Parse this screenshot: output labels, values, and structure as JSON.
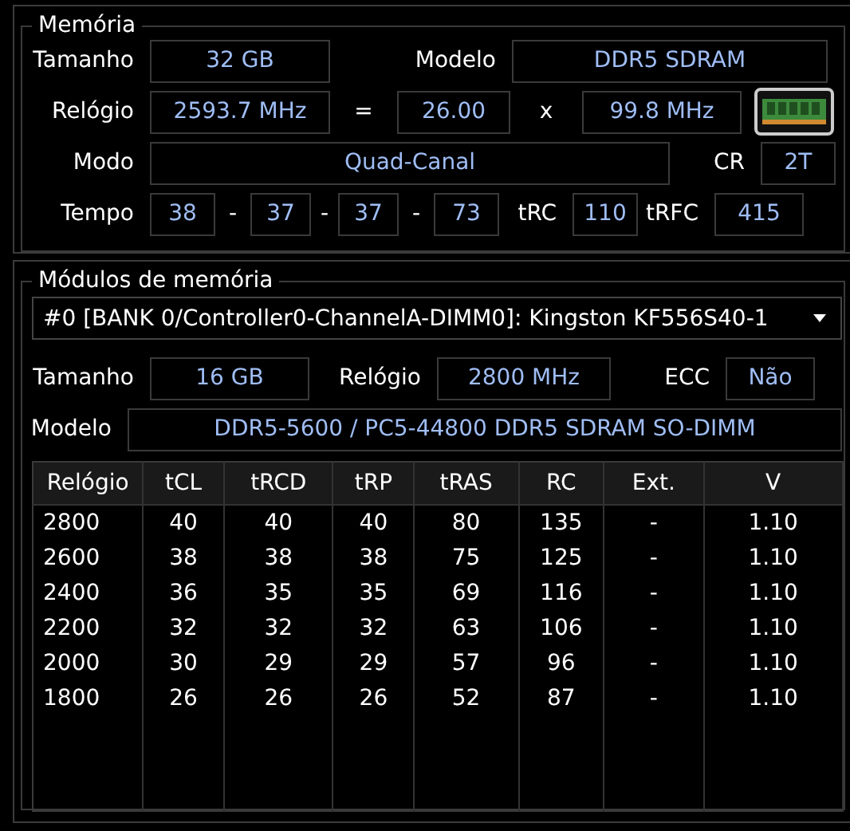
{
  "memory": {
    "title": "Memória",
    "size_label": "Tamanho",
    "size": "32 GB",
    "model_label": "Modelo",
    "model": "DDR5 SDRAM",
    "clock_label": "Relógio",
    "clock": "2593.7 MHz",
    "equals": "=",
    "multiplier": "26.00",
    "times": "x",
    "bus": "99.8 MHz",
    "mode_label": "Modo",
    "mode": "Quad-Canal",
    "cr_label": "CR",
    "cr": "2T",
    "timings_label": "Tempo",
    "timings": [
      "38",
      "37",
      "37",
      "73"
    ],
    "separators": [
      "-",
      "-",
      "-"
    ],
    "trc_label": "tRC",
    "trc": "110",
    "trfc_label": "tRFC",
    "trfc": "415"
  },
  "modules": {
    "title": "Módulos de memória",
    "selector": "#0 [BANK 0/Controller0-ChannelA-DIMM0]: Kingston KF556S40-1",
    "size_label": "Tamanho",
    "size": "16 GB",
    "clock_label": "Relógio",
    "clock": "2800 MHz",
    "ecc_label": "ECC",
    "ecc": "Não",
    "model_label": "Modelo",
    "model": "DDR5-5600 / PC5-44800 DDR5 SDRAM SO-DIMM",
    "table": {
      "columns": [
        "Relógio",
        "tCL",
        "tRCD",
        "tRP",
        "tRAS",
        "RC",
        "Ext.",
        "V"
      ],
      "rows": [
        [
          "2800",
          "40",
          "40",
          "40",
          "80",
          "135",
          "-",
          "1.10"
        ],
        [
          "2600",
          "38",
          "38",
          "38",
          "75",
          "125",
          "-",
          "1.10"
        ],
        [
          "2400",
          "36",
          "35",
          "35",
          "69",
          "116",
          "-",
          "1.10"
        ],
        [
          "2200",
          "32",
          "32",
          "32",
          "63",
          "106",
          "-",
          "1.10"
        ],
        [
          "2000",
          "30",
          "29",
          "29",
          "57",
          "96",
          "-",
          "1.10"
        ],
        [
          "1800",
          "26",
          "26",
          "26",
          "52",
          "87",
          "-",
          "1.10"
        ]
      ]
    }
  }
}
